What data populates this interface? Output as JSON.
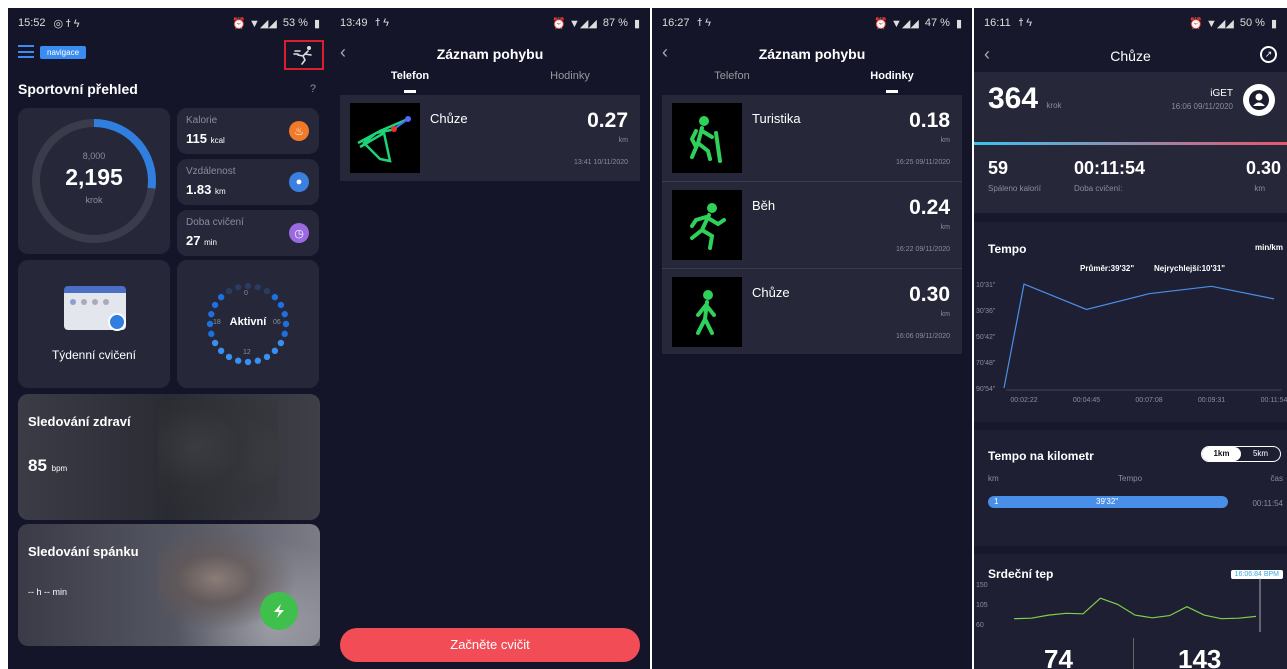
{
  "overview": {
    "status": {
      "time": "15:52",
      "battery": "53 %"
    },
    "nav_label": "navigace",
    "title": "Sportovní přehled",
    "help": "?",
    "steps_goal": "8,000",
    "steps": "2,195",
    "steps_unit": "krok",
    "steps_progress": 0.27,
    "cal_label": "Kalorie",
    "cal_value": "115",
    "cal_unit": "kcal",
    "dist_label": "Vzdálenost",
    "dist_value": "1.83",
    "dist_unit": "km",
    "time_label": "Doba cvičení",
    "time_value": "27",
    "time_unit": "min",
    "weekly_label": "Týdenní cvičení",
    "active_label": "Aktivní",
    "clock_0": "0",
    "clock_6": "06",
    "clock_12": "12",
    "clock_18": "18",
    "health_title": "Sledování zdraví",
    "health_value": "85",
    "health_unit": "bpm",
    "sleep_title": "Sledování spánku",
    "sleep_value": "-- h -- min"
  },
  "phone_records": {
    "status": {
      "time": "13:49",
      "battery": "87 %"
    },
    "title": "Záznam pohybu",
    "tab_phone": "Telefon",
    "tab_watch": "Hodinky",
    "records": [
      {
        "name": "Chůze",
        "value": "0.27",
        "unit": "km",
        "date": "13:41 10/11/2020"
      }
    ],
    "start_button": "Začněte cvičit"
  },
  "watch_records": {
    "status": {
      "time": "16:27",
      "battery": "47 %"
    },
    "title": "Záznam pohybu",
    "tab_phone": "Telefon",
    "tab_watch": "Hodinky",
    "records": [
      {
        "name": "Turistika",
        "value": "0.18",
        "unit": "km",
        "date": "16:25 09/11/2020",
        "icon": "hiking-icon"
      },
      {
        "name": "Běh",
        "value": "0.24",
        "unit": "km",
        "date": "16:22 09/11/2020",
        "icon": "running-icon"
      },
      {
        "name": "Chůze",
        "value": "0.30",
        "unit": "km",
        "date": "16:06 09/11/2020",
        "icon": "walking-icon"
      }
    ]
  },
  "detail": {
    "status": {
      "time": "16:11",
      "battery": "50 %"
    },
    "title": "Chůze",
    "steps": "364",
    "steps_unit": "krok",
    "brand": "iGET",
    "date": "16:06 09/11/2020",
    "cal_value": "59",
    "cal_label": "Spáleno kalorií",
    "duration_value": "00:11:54",
    "duration_label": "Doba cvičení:",
    "dist_value": "0.30",
    "dist_unit": "km",
    "tempo_title": "Tempo",
    "tempo_unit": "min/km",
    "tempo_avg": "Průměr:39'32\"",
    "tempo_best": "Nejrychlejší:10'31\"",
    "per_km_title": "Tempo na kilometr",
    "seg_1km": "1km",
    "seg_5km": "5km",
    "col_km": "km",
    "col_tempo": "Tempo",
    "col_time": "čas",
    "row_km": "1",
    "row_tempo": "39'32\"",
    "row_time": "00:11:54",
    "heart_title": "Srdeční tep",
    "heart_tooltip": "16:06:84 BPM",
    "heart_avg": "74",
    "heart_max": "143"
  },
  "chart_data": [
    {
      "type": "line",
      "title": "Tempo",
      "ylabel": "min/km",
      "x": [
        "00:02:22",
        "00:04:45",
        "00:07:08",
        "00:09:31",
        "00:11:54"
      ],
      "y_ticks": [
        "10'31\"",
        "30'36\"",
        "50'42\"",
        "70'48\"",
        "90'54\""
      ],
      "values_min": [
        10.6,
        30.2,
        18.0,
        12.3,
        22.0
      ],
      "color": "#4a8fe7"
    },
    {
      "type": "line",
      "title": "Srdeční tep",
      "y_ticks": [
        "150",
        "105",
        "60"
      ],
      "ylim": [
        60,
        150
      ],
      "values": [
        72,
        73,
        80,
        84,
        83,
        118,
        104,
        80,
        74,
        79,
        99,
        80,
        72,
        73,
        77
      ],
      "color": "#7ed04a"
    }
  ]
}
